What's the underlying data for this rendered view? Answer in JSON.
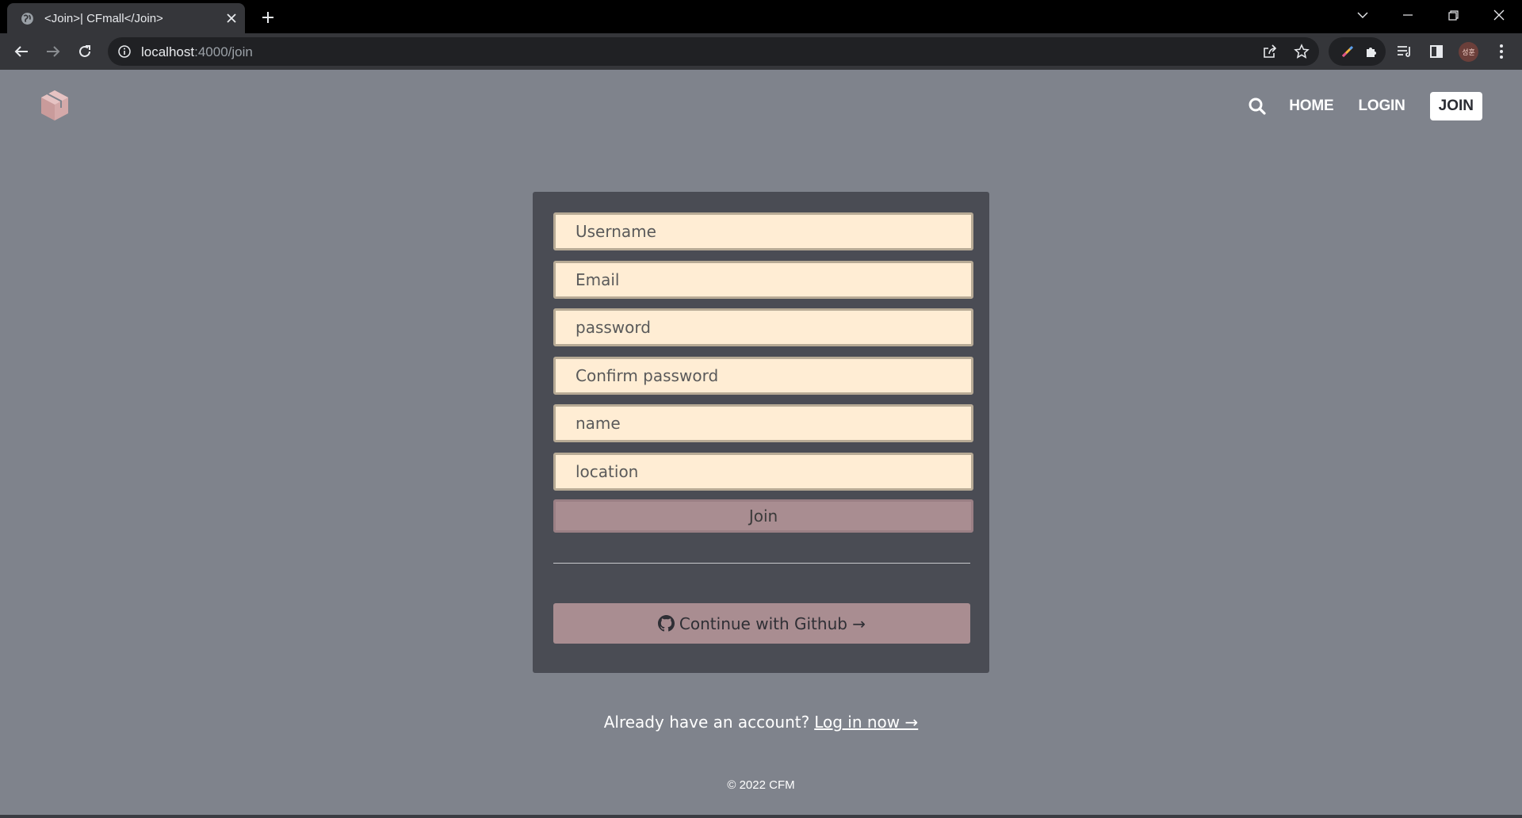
{
  "browser": {
    "tab_title": "<Join>| CFmall</Join>",
    "url_host": "localhost",
    "url_path": ":4000/join",
    "avatar_text": "성훈"
  },
  "header": {
    "logo_icon": "cube-icon",
    "search_icon": "search-icon",
    "nav": {
      "home": "HOME",
      "login": "LOGIN",
      "join": "JOIN"
    }
  },
  "form": {
    "fields": {
      "username": "Username",
      "email": "Email",
      "password": "password",
      "confirm_password": "Confirm password",
      "name": "name",
      "location": "location"
    },
    "submit_label": "Join",
    "github_label": "Continue with Github →"
  },
  "login_prompt": {
    "text": "Already have an account?",
    "link": "Log in now →"
  },
  "footer": {
    "copyright": "© 2022 CFM"
  },
  "colors": {
    "page_bg": "#7f838c",
    "card_bg": "#4a4c54",
    "input_bg": "#ffedd4",
    "button_bg": "#a98d91",
    "logo": "#d4a9a9"
  }
}
